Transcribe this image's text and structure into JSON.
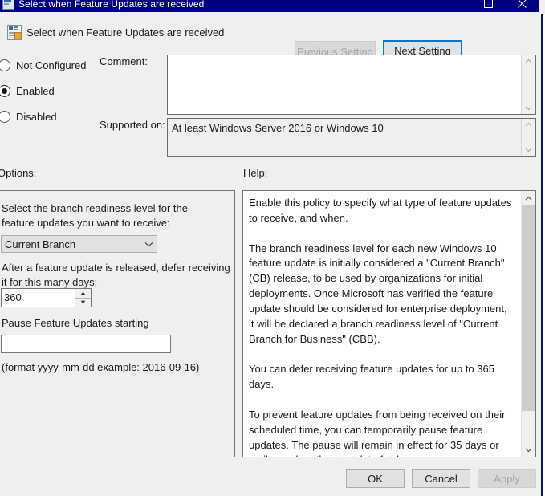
{
  "window": {
    "title": "Select when Feature Updates are received",
    "icon": "policy-setting-icon",
    "maximize_icon": "maximize-icon",
    "close_icon": "close-icon",
    "titlebar_color": "#000080",
    "accent_color": "#0078d7"
  },
  "header": {
    "icon": "policy-setting-icon",
    "title": "Select when Feature Updates are received",
    "prev_setting_label": "Previous Setting",
    "next_setting_label": "Next Setting"
  },
  "state": {
    "not_configured_label": "Not Configured",
    "enabled_label": "Enabled",
    "disabled_label": "Disabled",
    "selected": "Enabled"
  },
  "comment": {
    "label": "Comment:",
    "value": "",
    "scroll_up_icon": "chevron-up-icon",
    "scroll_down_icon": "chevron-down-icon"
  },
  "supported": {
    "label": "Supported on:",
    "value": "At least Windows Server 2016 or Windows 10",
    "scroll_up_icon": "chevron-up-icon",
    "scroll_down_icon": "chevron-down-icon"
  },
  "options": {
    "heading": "Options:",
    "branch_label": "Select the branch readiness level for the feature updates you want to receive:",
    "branch_value": "Current Branch",
    "branch_chevron_icon": "chevron-down-icon",
    "defer_label": "After a feature update is released, defer receiving it for this many days:",
    "defer_value": "360",
    "spin_up_icon": "spinner-up-icon",
    "spin_down_icon": "spinner-down-icon",
    "pause_label": "Pause Feature Updates starting",
    "pause_value": "",
    "pause_placeholder": "",
    "format_hint": "(format yyyy-mm-dd example: 2016-09-16)"
  },
  "help": {
    "heading": "Help:",
    "text": "Enable this policy to specify what type of feature updates to receive, and when.\n\nThe branch readiness level for each new Windows 10 feature update is initially considered a \"Current Branch\" (CB) release, to be used by organizations for initial deployments. Once Microsoft has verified the feature update should be considered for enterprise deployment, it will be declared a branch readiness level of \"Current Branch for Business\" (CBB).\n\nYou can defer receiving feature updates for up to 365 days.\n\nTo prevent feature updates from being received on their scheduled time, you can temporarily pause feature updates. The pause will remain in effect for 35 days or until you clear the start date field.\n\nTo resume receiving Feature Updates which are paused, clear the start date field.\n\nIf you disable or do not configure this policy, Windows Update",
    "scroll_up_icon": "chevron-up-icon",
    "scroll_down_icon": "chevron-down-icon"
  },
  "footer": {
    "ok_label": "OK",
    "cancel_label": "Cancel",
    "apply_label": "Apply"
  }
}
